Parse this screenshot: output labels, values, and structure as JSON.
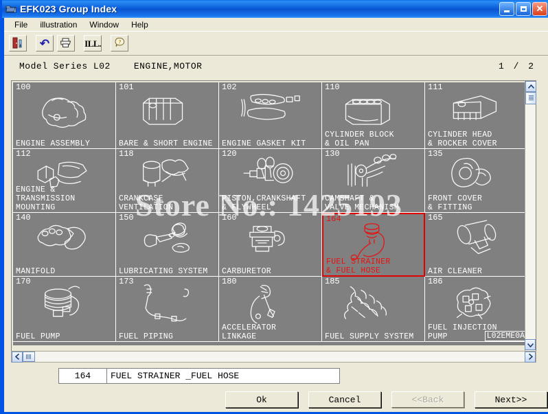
{
  "window": {
    "title": "EFK023 Group Index",
    "title_icon": "folder-icon",
    "minimize_label": "",
    "maximize_label": "",
    "close_label": "✕"
  },
  "menubar": {
    "items": [
      {
        "label": "File",
        "name": "menu-file"
      },
      {
        "label": "illustration",
        "name": "menu-illustration"
      },
      {
        "label": "Window",
        "name": "menu-window"
      },
      {
        "label": "Help",
        "name": "menu-help"
      }
    ]
  },
  "toolbar": {
    "buttons": [
      {
        "icon": "exit-door-icon",
        "glyph": "⬛"
      },
      {
        "icon": "undo-icon",
        "glyph": "↶"
      },
      {
        "icon": "print-icon",
        "glyph": "⎙"
      },
      {
        "icon": "illustration-icon",
        "glyph": "ILL."
      },
      {
        "icon": "help-question-icon",
        "glyph": "?"
      }
    ]
  },
  "header": {
    "model_series": "Model Series  L02",
    "group_description": "ENGINE,MOTOR",
    "page": "1 /  2"
  },
  "watermark": {
    "text": "Store No.: 1425193"
  },
  "corner_tag": {
    "text": "L02EME0A"
  },
  "grid": {
    "selected_code": "164",
    "selected_color": "#e81010",
    "cells": [
      {
        "code": "100",
        "label": "ENGINE ASSEMBLY",
        "selected": false,
        "art": "engine-assembly-art"
      },
      {
        "code": "101",
        "label": "BARE & SHORT ENGINE",
        "selected": false,
        "art": "bare-short-engine-art"
      },
      {
        "code": "102",
        "label": "ENGINE GASKET KIT",
        "selected": false,
        "art": "gasket-kit-art"
      },
      {
        "code": "110",
        "label": "CYLINDER BLOCK\n& OIL PAN",
        "selected": false,
        "art": "cylinder-block-art"
      },
      {
        "code": "111",
        "label": "CYLINDER HEAD\n& ROCKER COVER",
        "selected": false,
        "art": "cylinder-head-art"
      },
      {
        "code": "112",
        "label": "ENGINE &\nTRANSMISSION\nMOUNTING",
        "selected": false,
        "art": "engine-mounting-art"
      },
      {
        "code": "118",
        "label": "CRANKCASE\nVENTILATION",
        "selected": false,
        "art": "crankcase-vent-art"
      },
      {
        "code": "120",
        "label": "PISTON,CRANKSHAFT\n& FLYWHEEL",
        "selected": false,
        "art": "piston-crankshaft-art"
      },
      {
        "code": "130",
        "label": "CAMSHAFT &\nVALVE MECHANISM",
        "selected": false,
        "art": "camshaft-art"
      },
      {
        "code": "135",
        "label": "FRONT COVER\n& FITTING",
        "selected": false,
        "art": "front-cover-art"
      },
      {
        "code": "140",
        "label": "MANIFOLD",
        "selected": false,
        "art": "manifold-art"
      },
      {
        "code": "150",
        "label": "LUBRICATING SYSTEM",
        "selected": false,
        "art": "lubricating-art"
      },
      {
        "code": "160",
        "label": "CARBURETOR",
        "selected": false,
        "art": "carburetor-art"
      },
      {
        "code": "164",
        "label": "FUEL STRAINER\n& FUEL HOSE",
        "selected": true,
        "art": "fuel-strainer-art"
      },
      {
        "code": "165",
        "label": "AIR CLEANER",
        "selected": false,
        "art": "air-cleaner-art"
      },
      {
        "code": "170",
        "label": "FUEL PUMP",
        "selected": false,
        "art": "fuel-pump-art"
      },
      {
        "code": "173",
        "label": "FUEL PIPING",
        "selected": false,
        "art": "fuel-piping-art"
      },
      {
        "code": "180",
        "label": "ACCELERATOR\nLINKAGE",
        "selected": false,
        "art": "accelerator-linkage-art"
      },
      {
        "code": "185",
        "label": "FUEL SUPPLY SYSTEM",
        "selected": false,
        "art": "fuel-supply-art"
      },
      {
        "code": "186",
        "label": "FUEL INJECTION\nPUMP",
        "selected": false,
        "art": "fuel-injection-pump-art"
      }
    ]
  },
  "form": {
    "code_value": "164",
    "description_value": "FUEL STRAINER _FUEL HOSE"
  },
  "buttons": {
    "ok": "Ok",
    "cancel": "Cancel",
    "back": "<<Back",
    "next": "Next>>"
  },
  "scrollbars": {
    "v_up": "▲",
    "v_down": "▼",
    "h_left": "◀",
    "h_right": "▶"
  }
}
